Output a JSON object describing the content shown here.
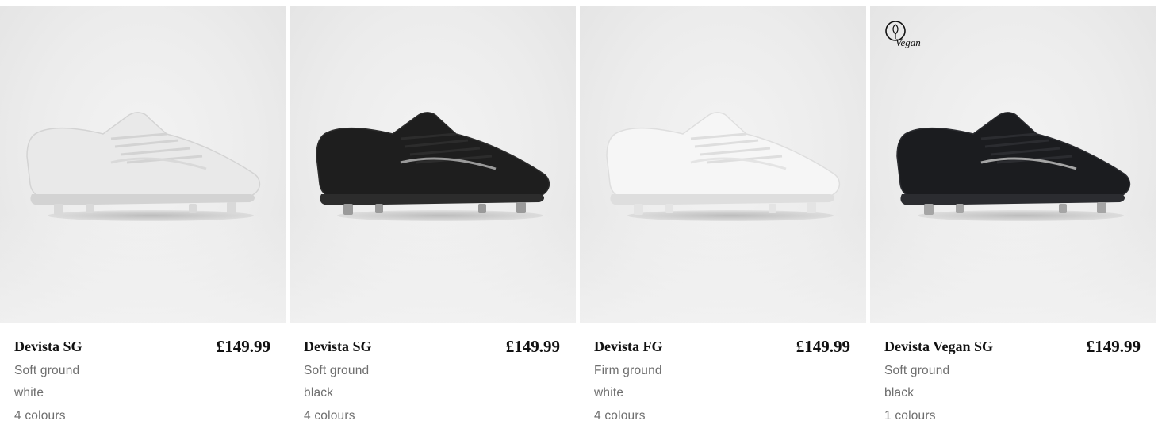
{
  "products": [
    {
      "name": "Devista SG",
      "price": "£149.99",
      "ground": "Soft ground",
      "colour": "white",
      "colours_count": "4 colours",
      "boot_color": "#e9e9e9",
      "boot_shade": "#d3d3d3",
      "stud_color": "#d9d9d9",
      "vegan": false
    },
    {
      "name": "Devista SG",
      "price": "£149.99",
      "ground": "Soft ground",
      "colour": "black",
      "colours_count": "4 colours",
      "boot_color": "#1e1e1e",
      "boot_shade": "#2c2c2c",
      "stud_color": "#9a9a9a",
      "vegan": false
    },
    {
      "name": "Devista FG",
      "price": "£149.99",
      "ground": "Firm ground",
      "colour": "white",
      "colours_count": "4 colours",
      "boot_color": "#f6f6f6",
      "boot_shade": "#dedede",
      "stud_color": "#e4e4e4",
      "vegan": false
    },
    {
      "name": "Devista Vegan SG",
      "price": "£149.99",
      "ground": "Soft ground",
      "colour": "black",
      "colours_count": "1 colours",
      "boot_color": "#1b1c1f",
      "boot_shade": "#2b2c30",
      "stud_color": "#a5a5a5",
      "vegan": true,
      "vegan_badge": "Vegan"
    }
  ]
}
